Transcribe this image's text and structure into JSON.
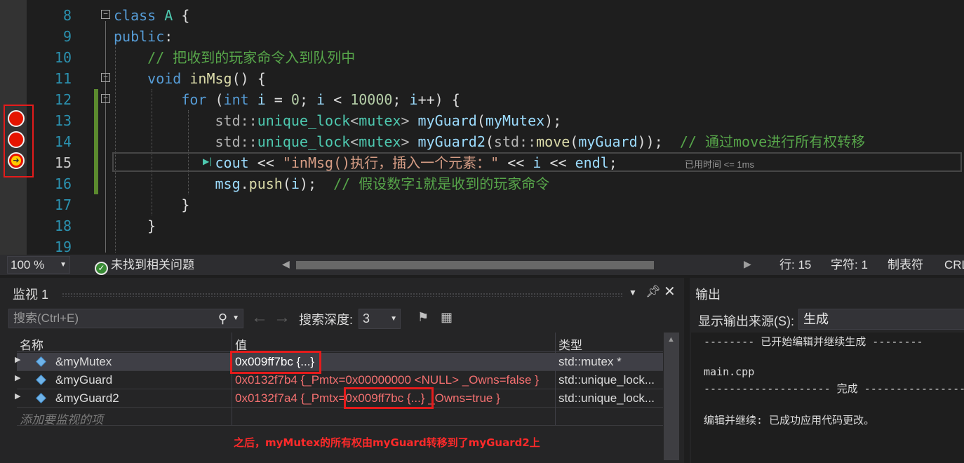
{
  "editor": {
    "lines": [
      {
        "num": "8",
        "tokens": [
          [
            "kw",
            "class"
          ],
          [
            "pl",
            " "
          ],
          [
            "cls",
            "A"
          ],
          [
            "pl",
            " {"
          ]
        ]
      },
      {
        "num": "9",
        "tokens": [
          [
            "kw",
            "public"
          ],
          [
            "pl",
            ":"
          ]
        ]
      },
      {
        "num": "10",
        "tokens": [
          [
            "pl",
            "    "
          ],
          [
            "cmt",
            "// 把收到的玩家命令入到队列中"
          ]
        ]
      },
      {
        "num": "11",
        "tokens": [
          [
            "pl",
            "    "
          ],
          [
            "kw",
            "void"
          ],
          [
            "pl",
            " "
          ],
          [
            "fn",
            "inMsg"
          ],
          [
            "pl",
            "() {"
          ]
        ]
      },
      {
        "num": "12",
        "tokens": [
          [
            "pl",
            "        "
          ],
          [
            "kw",
            "for"
          ],
          [
            "pl",
            " ("
          ],
          [
            "kw",
            "int"
          ],
          [
            "pl",
            " "
          ],
          [
            "var",
            "i"
          ],
          [
            "pl",
            " = "
          ],
          [
            "num",
            "0"
          ],
          [
            "pl",
            "; "
          ],
          [
            "var",
            "i"
          ],
          [
            "pl",
            " < "
          ],
          [
            "num",
            "10000"
          ],
          [
            "pl",
            "; "
          ],
          [
            "var",
            "i"
          ],
          [
            "pl",
            "++) {"
          ]
        ]
      },
      {
        "num": "13",
        "tokens": [
          [
            "pl",
            "            "
          ],
          [
            "op",
            "std::"
          ],
          [
            "cls",
            "unique_lock"
          ],
          [
            "op",
            "<"
          ],
          [
            "cls",
            "mutex"
          ],
          [
            "op",
            ">"
          ],
          [
            "pl",
            " "
          ],
          [
            "var",
            "myGuard"
          ],
          [
            "pl",
            "("
          ],
          [
            "var",
            "myMutex"
          ],
          [
            "pl",
            ");"
          ]
        ]
      },
      {
        "num": "14",
        "tokens": [
          [
            "pl",
            "            "
          ],
          [
            "op",
            "std::"
          ],
          [
            "cls",
            "unique_lock"
          ],
          [
            "op",
            "<"
          ],
          [
            "cls",
            "mutex"
          ],
          [
            "op",
            ">"
          ],
          [
            "pl",
            " "
          ],
          [
            "var",
            "myGuard2"
          ],
          [
            "pl",
            "("
          ],
          [
            "op",
            "std::"
          ],
          [
            "fn",
            "move"
          ],
          [
            "pl",
            "("
          ],
          [
            "var",
            "myGuard"
          ],
          [
            "pl",
            "));  "
          ],
          [
            "cmt",
            "// 通过move进行所有权转移"
          ]
        ]
      },
      {
        "num": "15",
        "tokens": [
          [
            "pl",
            "            "
          ],
          [
            "var",
            "cout"
          ],
          [
            "pl",
            " << "
          ],
          [
            "str",
            "\"inMsg()执行，插入一个元素：\""
          ],
          [
            "pl",
            " << "
          ],
          [
            "var",
            "i"
          ],
          [
            "pl",
            " << "
          ],
          [
            "var",
            "endl"
          ],
          [
            "pl",
            ";"
          ]
        ]
      },
      {
        "num": "16",
        "tokens": [
          [
            "pl",
            "            "
          ],
          [
            "var",
            "msg"
          ],
          [
            "pl",
            "."
          ],
          [
            "fn",
            "push"
          ],
          [
            "pl",
            "("
          ],
          [
            "var",
            "i"
          ],
          [
            "pl",
            ");  "
          ],
          [
            "cmt",
            "// 假设数字i就是收到的玩家命令"
          ]
        ]
      },
      {
        "num": "17",
        "tokens": [
          [
            "pl",
            "        }"
          ]
        ]
      },
      {
        "num": "18",
        "tokens": [
          [
            "pl",
            "    }"
          ]
        ]
      },
      {
        "num": "19",
        "tokens": [
          [
            "pl",
            ""
          ]
        ]
      }
    ],
    "current_line": "15",
    "perf_tip": "已用时间 <= 1ms",
    "run_to_click_glyph": "▶|"
  },
  "statusbar": {
    "zoom": "100 %",
    "issues": "未找到相关问题",
    "line": "行: 15",
    "char": "字符: 1",
    "indent": "制表符",
    "eol": "CRL"
  },
  "watch": {
    "title": "监视 1",
    "search_placeholder": "搜索(Ctrl+E)",
    "depth_label": "搜索深度:",
    "depth_value": "3",
    "columns": [
      "名称",
      "值",
      "类型"
    ],
    "rows": [
      {
        "name": "&myMutex",
        "value": "0x009ff7bc {...}",
        "type": "std::mutex *"
      },
      {
        "name": "&myGuard",
        "value": "0x0132f7b4 {_Pmtx=0x00000000 <NULL> _Owns=false }",
        "type": "std::unique_lock..."
      },
      {
        "name": "&myGuard2",
        "value_prefix": "0x0132f7a4 {_Pmtx=",
        "value_highlight": "0x009ff7bc {...}",
        "value_suffix": " _Owns=true }",
        "type": "std::unique_lock..."
      }
    ],
    "add_item": "添加要监视的项",
    "annotation": "之后，myMutex的所有权由myGuard转移到了myGuard2上"
  },
  "output": {
    "title": "输出",
    "source_label": "显示输出来源(S):",
    "source_value": "生成",
    "lines": [
      "-------- 已开始编辑并继续生成 --------",
      "",
      "main.cpp",
      "-------------------- 完成 -------------------",
      "",
      "编辑并继续: 已成功应用代码更改。"
    ]
  },
  "colors": {
    "breakpoint": "#e51400",
    "highlight_box": "#e51b1b",
    "annotation": "#ff2a2a"
  }
}
